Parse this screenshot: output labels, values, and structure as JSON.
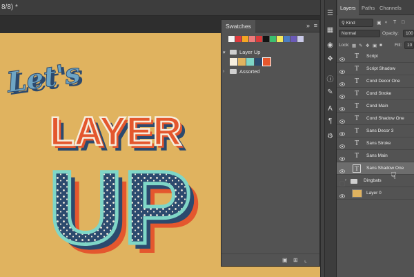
{
  "document": {
    "tab_title": "8/8) *"
  },
  "artwork": {
    "line1": "Let's",
    "line2": "LAYER",
    "line3": "UP",
    "colors": {
      "background": "#e0b35f",
      "navy": "#2c4a6e",
      "orange": "#e4572e",
      "cream": "#f6eede",
      "mint": "#7fd6c7",
      "sky": "#6ea5c4"
    }
  },
  "swatches": {
    "panel_title": "Swatches",
    "collapse_icon": "double-chevron",
    "menu_icon": "panel-menu-icon",
    "recent_colors": [
      "#f4f4f4",
      "#e03a3e",
      "#f5a623",
      "#ed7b7b",
      "#d93a3a",
      "#141414",
      "#3cbf6f",
      "#f2e85c",
      "#4a7cc2",
      "#6b5ab8",
      "#c9c9e8"
    ],
    "groups": [
      {
        "name": "Layer Up",
        "expanded": true,
        "colors": [
          "#f6eede",
          "#e0b35f",
          "#7fd6c7",
          "#2c4a6e",
          "#e4572e"
        ]
      },
      {
        "name": "Assorted",
        "expanded": false
      }
    ],
    "footer": {
      "folder_icon": "folder-icon",
      "new_icon": "new-swatch-icon",
      "trash_icon": "trash-icon"
    }
  },
  "layers": {
    "tabs": [
      {
        "label": "Layers",
        "active": true
      },
      {
        "label": "Paths"
      },
      {
        "label": "Channels"
      }
    ],
    "filter": {
      "label": "Kind"
    },
    "blend_mode": "Normal",
    "opacity_label": "Opacity:",
    "opacity_value": "100",
    "lock_label": "Lock:",
    "fill_label": "Fill:",
    "fill_value": "10",
    "items": [
      {
        "name": "Script",
        "kind": "text",
        "visible": true
      },
      {
        "name": "Script Shadow",
        "kind": "text",
        "visible": true
      },
      {
        "name": "Cond Decor One",
        "kind": "text",
        "visible": true
      },
      {
        "name": "Cond Stroke",
        "kind": "text",
        "visible": true
      },
      {
        "name": "Cond Main",
        "kind": "text",
        "visible": true
      },
      {
        "name": "Cond Shadow One",
        "kind": "text",
        "visible": true
      },
      {
        "name": "Sans Decor 3",
        "kind": "text",
        "visible": true
      },
      {
        "name": "Sans Stroke",
        "kind": "text",
        "visible": true
      },
      {
        "name": "Sans Main",
        "kind": "text",
        "visible": true
      },
      {
        "name": "Sans Shadow One",
        "kind": "text",
        "visible": true,
        "selected": true
      },
      {
        "name": "Dingbats",
        "kind": "group",
        "visible": false
      },
      {
        "name": "Layer 0",
        "kind": "pixel",
        "visible": true
      }
    ]
  }
}
